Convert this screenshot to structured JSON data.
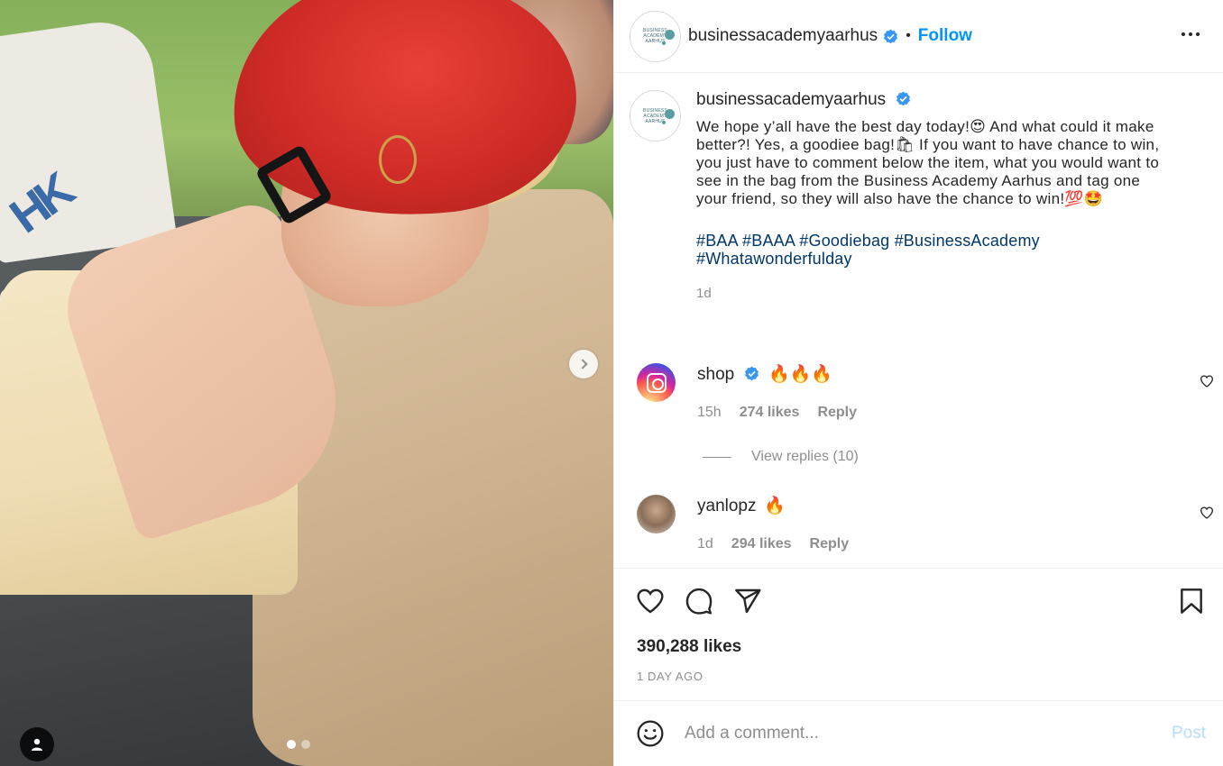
{
  "post": {
    "username": "businessacademyaarhus",
    "follow_label": "Follow",
    "separator": "•",
    "avatar_logo_text": "BUSINESS ACADEMY AARHUS",
    "caption": {
      "username": "businessacademyaarhus",
      "text": "We hope y’all have the best day today!😍 And what could it make better?! Yes, a goodiee bag!🛍 If you want to have chance to win, you just have to comment below the item, what you would want to see in the bag from the Business Academy Aarhus and tag one your friend, so they will also have the chance to win!💯🤩",
      "hashtags": "#BAA #BAAA #Goodiebag #BusinessAcademy #Whatawonderfulday",
      "time": "1d"
    },
    "comments": [
      {
        "username": "shop",
        "text": "🔥🔥🔥",
        "time": "15h",
        "likes": "274 likes",
        "reply_label": "Reply",
        "view_replies": "View replies (10)"
      },
      {
        "username": "yanlopz",
        "text": "🔥",
        "time": "1d",
        "likes": "294 likes",
        "reply_label": "Reply"
      }
    ],
    "likes_count": "390,288 likes",
    "date_label": "1 DAY AGO",
    "comment_placeholder": "Add a comment...",
    "post_label": "Post"
  },
  "photo": {
    "bag_logo": "HK",
    "carousel": {
      "count": 2,
      "active_index": 0
    }
  },
  "colors": {
    "accent": "#0095f6",
    "verified": "#3897f0",
    "hashtag": "#00376b",
    "muted": "#8e8e8e"
  },
  "icons": {
    "next": "chevron-right-icon",
    "tag": "user-tag-icon",
    "more": "more-options-icon",
    "verified": "verified-badge-icon",
    "like": "heart-icon",
    "comment": "comment-bubble-icon",
    "share": "paper-plane-icon",
    "save": "bookmark-icon",
    "emoji": "emoji-icon"
  }
}
